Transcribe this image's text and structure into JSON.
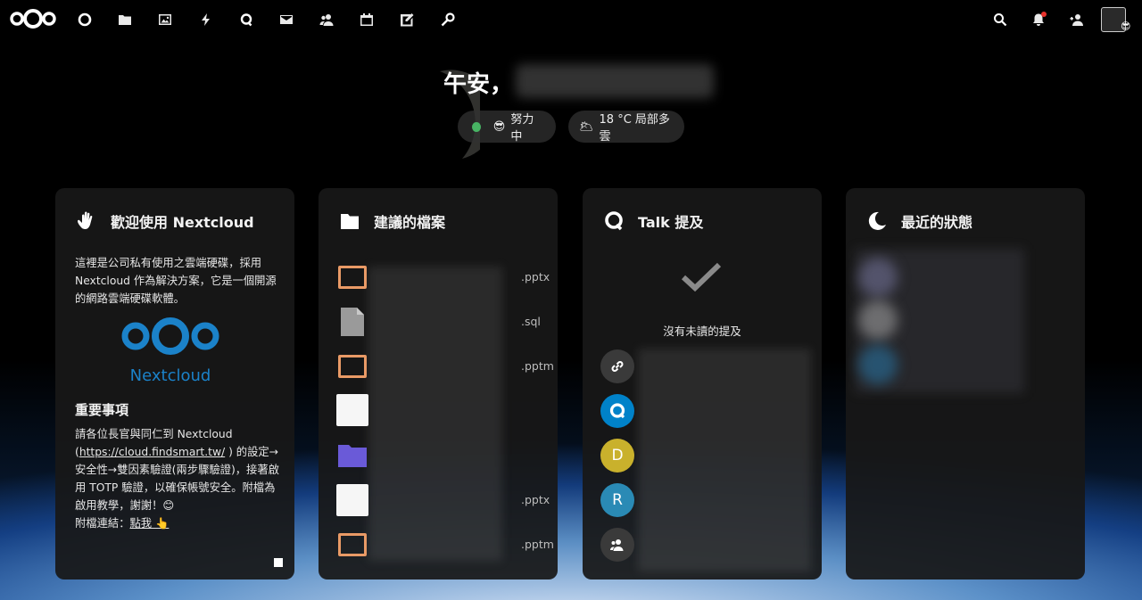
{
  "header": {
    "apps": [
      {
        "name": "dashboard-icon"
      },
      {
        "name": "files-icon"
      },
      {
        "name": "photos-icon"
      },
      {
        "name": "activity-icon"
      },
      {
        "name": "talk-icon"
      },
      {
        "name": "mail-icon"
      },
      {
        "name": "contacts-icon"
      },
      {
        "name": "calendar-icon"
      },
      {
        "name": "notes-icon"
      },
      {
        "name": "passwords-icon"
      }
    ],
    "right": {
      "search": "search-icon",
      "notifications": "bell-icon",
      "contacts": "contacts-menu-icon",
      "avatar_emoji": "😎"
    }
  },
  "greeting": {
    "text": "午安，",
    "status": {
      "emoji": "😎",
      "label": "努力中",
      "online_color": "#48b464"
    },
    "weather": {
      "emoji": "🌥",
      "label": "18 °C 局部多雲"
    }
  },
  "panels": {
    "welcome": {
      "title": "歡迎使用 Nextcloud",
      "intro": "這裡是公司私有使用之雲端硬碟，採用 Nextcloud 作為解決方案，它是一個開源的網路雲端硬碟軟體。",
      "logo_text": "Nextcloud",
      "important_title": "重要事項",
      "notice_prefix": "請各位長官與同仁到 Nextcloud (",
      "notice_link": "https://cloud.findsmart.tw/",
      "notice_suffix": " ) 的設定→安全性→雙因素驗證(兩步驟驗證)，接著啟用 TOTP 驗證，以確保帳號安全。附檔為啟用教學，謝謝！😊",
      "attach_prefix": "附檔連結：",
      "attach_link": "點我 👆"
    },
    "files": {
      "title": "建議的檔案",
      "items": [
        {
          "type": "ppt",
          "ext": ".pptx"
        },
        {
          "type": "generic",
          "ext": ".sql"
        },
        {
          "type": "ppt",
          "ext": ".pptm"
        },
        {
          "type": "thumb",
          "ext": ""
        },
        {
          "type": "folder",
          "ext": ""
        },
        {
          "type": "thumb",
          "ext": ".pptx"
        },
        {
          "type": "ppt",
          "ext": ".pptm"
        }
      ]
    },
    "talk": {
      "title": "Talk 提及",
      "empty": "沒有未讀的提及",
      "avatars": [
        {
          "kind": "link-icon",
          "letter": "",
          "color": "#3a3a3a"
        },
        {
          "kind": "talk-icon",
          "letter": "",
          "color": "#0082c9"
        },
        {
          "kind": "letter",
          "letter": "D",
          "color": "#c9b12c"
        },
        {
          "kind": "letter",
          "letter": "R",
          "color": "#2a8ab5"
        },
        {
          "kind": "group-icon",
          "letter": "",
          "color": "#3a3a3a"
        }
      ]
    },
    "status": {
      "title": "最近的狀態"
    }
  }
}
